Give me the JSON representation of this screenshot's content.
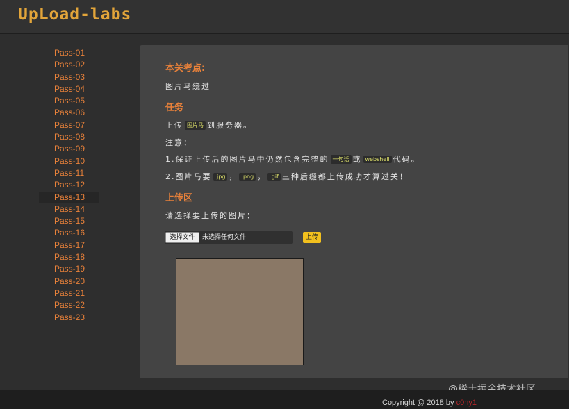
{
  "header": {
    "logo": "UpLoad-labs"
  },
  "sidebar": {
    "active": "Pass-13",
    "items": [
      "Pass-01",
      "Pass-02",
      "Pass-03",
      "Pass-04",
      "Pass-05",
      "Pass-06",
      "Pass-07",
      "Pass-08",
      "Pass-09",
      "Pass-10",
      "Pass-11",
      "Pass-12",
      "Pass-13",
      "Pass-14",
      "Pass-15",
      "Pass-16",
      "Pass-17",
      "Pass-18",
      "Pass-19",
      "Pass-20",
      "Pass-21",
      "Pass-22",
      "Pass-23"
    ]
  },
  "main": {
    "section_points": "本关考点:",
    "points_text": "图片马绕过",
    "section_task": "任务",
    "task_pre": "上传",
    "task_code": "图片马",
    "task_post": "到服务器。",
    "note_label": "注意：",
    "note1_pre": "1.保证上传后的图片马中仍然包含完整的",
    "note1_code1": "一句话",
    "note1_mid": "或",
    "note1_code2": "webshell",
    "note1_post": "代码。",
    "note2_pre": "2.图片马要",
    "note2_ext1": ".jpg",
    "note2_sep1": "，",
    "note2_ext2": ".png",
    "note2_sep2": "，",
    "note2_ext3": ".gif",
    "note2_post": "三种后缀都上传成功才算过关！",
    "section_upload": "上传区",
    "select_prompt": "请选择要上传的图片：",
    "choose_file_label": "选择文件",
    "no_file_label": "未选择任何文件",
    "upload_label": "上传"
  },
  "watermark": "@稀土掘金技术社区",
  "footer": {
    "copyright": "Copyright @ 2018 by",
    "author": "c0ny1"
  },
  "colors": {
    "accent": "#e8813a",
    "logo": "#e3a53a",
    "upload_button": "#f2c01e",
    "author": "#b3262a"
  }
}
